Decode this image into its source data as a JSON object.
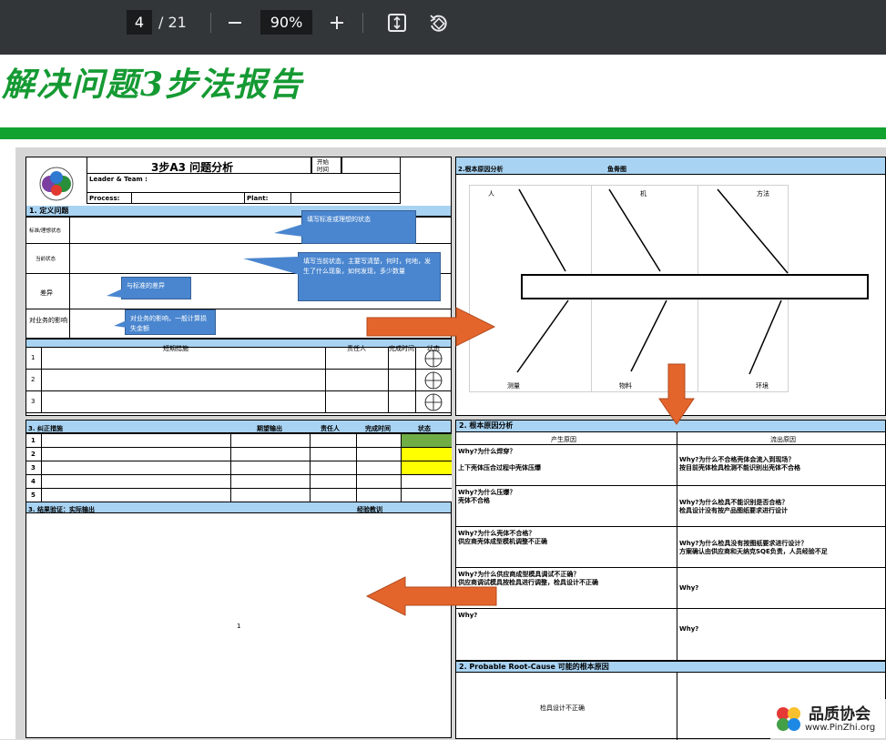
{
  "toolbar": {
    "page_current": "4",
    "page_sep_total": "/ 21",
    "zoom": "90%"
  },
  "doc_title": "解决问题3步法报告",
  "form": {
    "title": "3步A3 问题分析",
    "start_time_label": "开始\n时间",
    "leader_team": "Leader & Team :",
    "process": "Process:",
    "plant": "Plant:",
    "section1": "1. 定义问题",
    "row_standard": "标准/理想状态",
    "row_current": "当前状态",
    "row_diff": "差异",
    "row_impact": "对业务的影响",
    "callout_standard": "填写标准或理想的状态",
    "callout_current": "填写当前状态，主要写清楚，何时，何地，发生了什么现象，如何发现，多少数量",
    "callout_diff": "与标准的差异",
    "callout_impact": "对业务的影响，一般计算损失金额",
    "short_term_cols": [
      "短期措施",
      "责任人",
      "完成时间",
      "状态"
    ],
    "short_term_rows": [
      "1",
      "2",
      "3"
    ],
    "section3": "3. 纠正措施",
    "corrective_cols": [
      "期望输出",
      "责任人",
      "完成时间",
      "状态"
    ],
    "corrective_rows": [
      "1",
      "2",
      "3",
      "4",
      "5"
    ],
    "status_colors": [
      "#70ad47",
      "#ffff00",
      "#ffff00",
      "#ffffff",
      "#ffffff"
    ],
    "section3b": "3. 结果验证：实际输出",
    "lessons": "经验教训",
    "page_number": "1"
  },
  "fishbone": {
    "header": "2.根本原因分析",
    "header_right": "鱼骨图",
    "top_labels": [
      "人",
      "机",
      "方法"
    ],
    "bottom_labels": [
      "测量",
      "物料",
      "环境"
    ]
  },
  "root_cause": {
    "header": "2. 根本原因分析",
    "col_left": "产生原因",
    "col_right": "流出原因",
    "rows": [
      {
        "left": "Why?为什么焊穿？\n\n上下壳体压合过程中壳体压爆",
        "right": "Why?为什么不合格壳体会流入到现场？\n按目前壳体检具检测不能识别出壳体不合格"
      },
      {
        "left": "Why?为什么压爆？\n壳体不合格",
        "right": "Why?为什么检具不能识别是否合格？\n检具设计没有按产品图纸要求进行设计"
      },
      {
        "left": "Why?为什么壳体不合格？\n供应商壳体成型模机调整不正确",
        "right": "Why?为什么检具没有按图纸要求进行设计？\n方案确认由供应商和天纳克SQE负责，人员经验不足"
      },
      {
        "left": "Why?为什么供应商成型模具调试不正确？\n供应商调试模具按检具进行调整，检具设计不正确",
        "right": "Why?"
      },
      {
        "left": "Why?",
        "right": "Why?"
      }
    ]
  },
  "probable": {
    "header": "2. Probable Root-Cause 可能的根本原因",
    "left": "检具设计不正确"
  },
  "watermark": {
    "brand": "品质协会",
    "url": "www.PinZhi.org"
  },
  "colors": {
    "title_green": "#159a33",
    "header_blue": "#a9d3f2",
    "arrow_orange": "#e4652c",
    "callout_blue": "#4a86cf"
  }
}
